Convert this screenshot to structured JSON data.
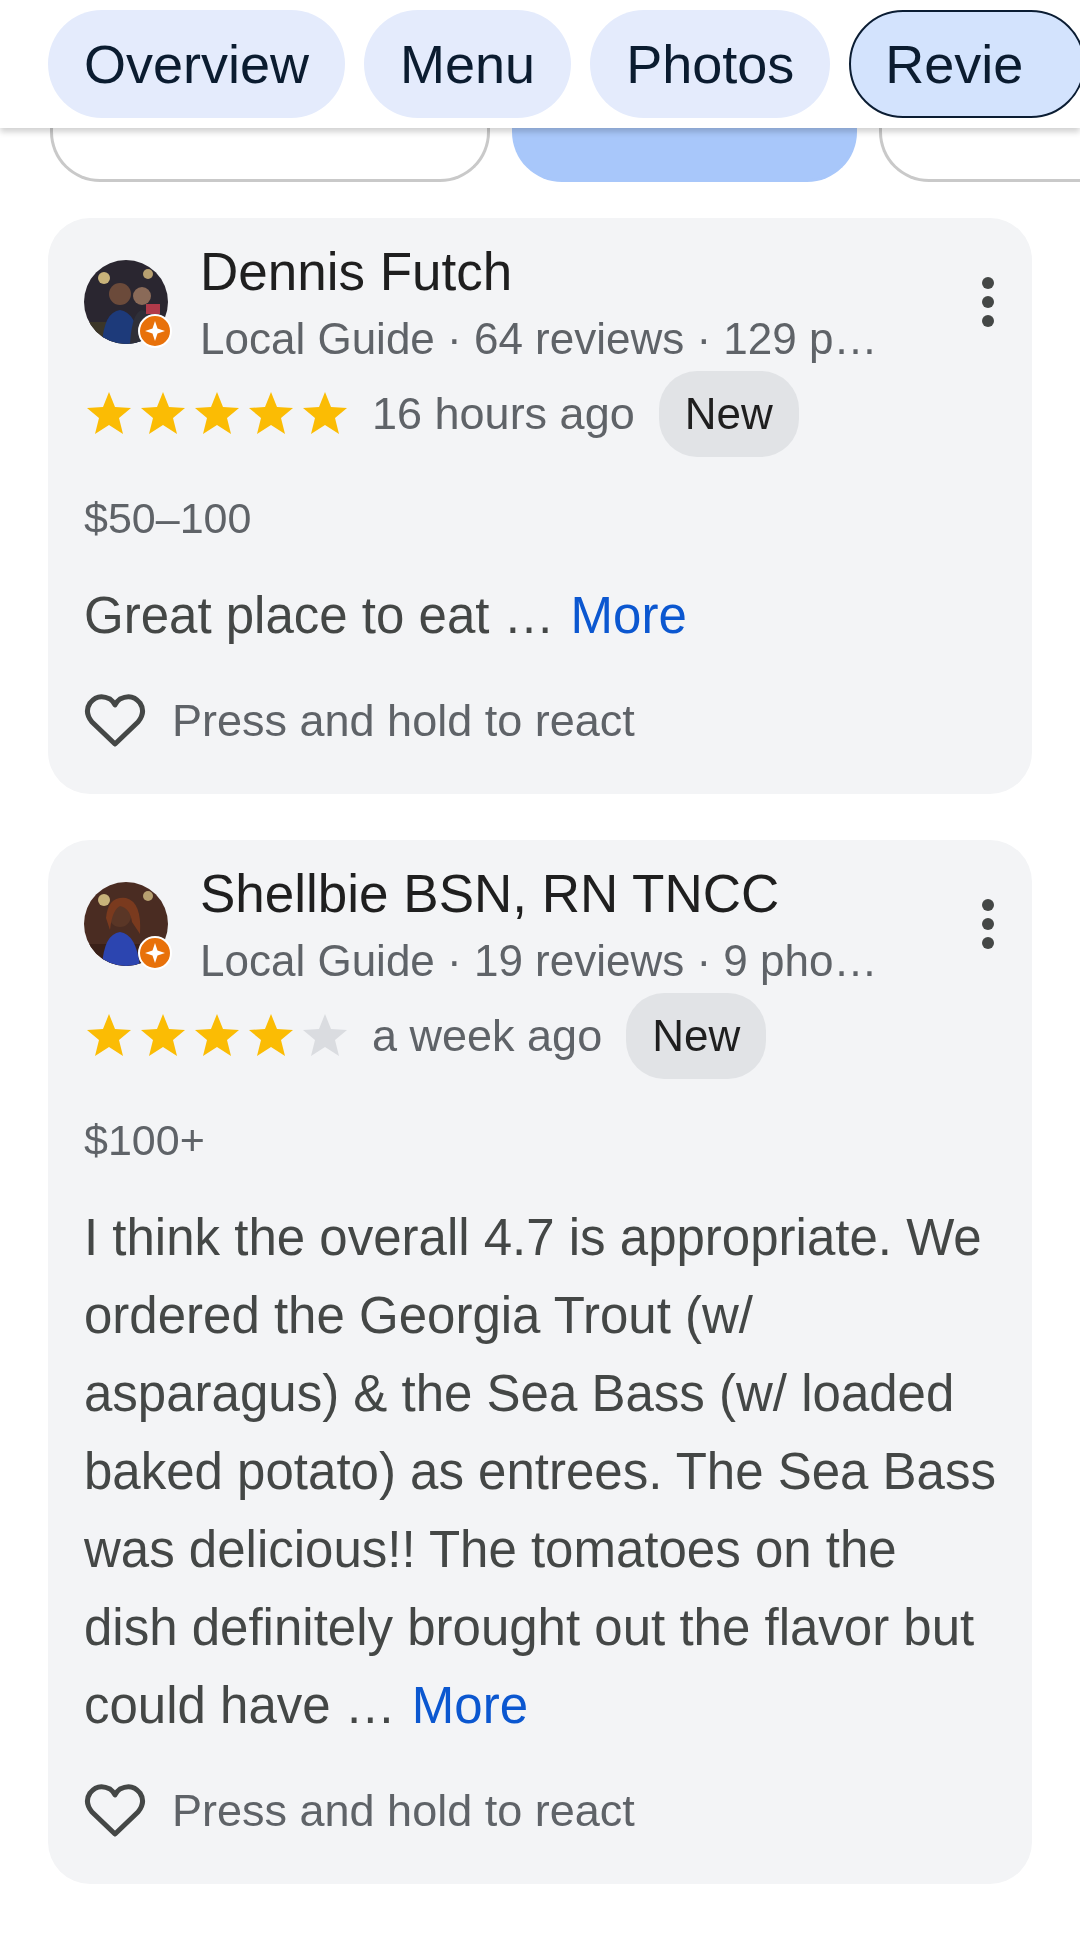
{
  "tabs": [
    {
      "label": "Overview",
      "selected": false
    },
    {
      "label": "Menu",
      "selected": false
    },
    {
      "label": "Photos",
      "selected": false
    },
    {
      "label": "Revie",
      "selected": true
    }
  ],
  "sort_chips": [
    {
      "selected": false
    },
    {
      "selected": true
    },
    {
      "selected": false
    }
  ],
  "reviews": [
    {
      "name": "Dennis Futch",
      "meta": "Local Guide · 64 reviews · 129 p…",
      "stars": 5,
      "time": "16 hours ago",
      "badge": "New",
      "price": "$50–100",
      "text": "Great place to eat …",
      "more": "More",
      "react": "Press and hold to react"
    },
    {
      "name": "Shellbie BSN, RN TNCC",
      "meta": "Local Guide · 19 reviews · 9 pho…",
      "stars": 4,
      "time": "a week ago",
      "badge": "New",
      "price": "$100+",
      "text": "I think the overall 4.7 is appropriate. We ordered the Georgia Trout (w/ asparagus) & the Sea Bass (w/ loaded baked potato) as entrees. The Sea Bass was delicious!! The tomatoes on the dish definitely brought out the flavor but could have …",
      "more": "More",
      "react": "Press and hold to react"
    }
  ]
}
